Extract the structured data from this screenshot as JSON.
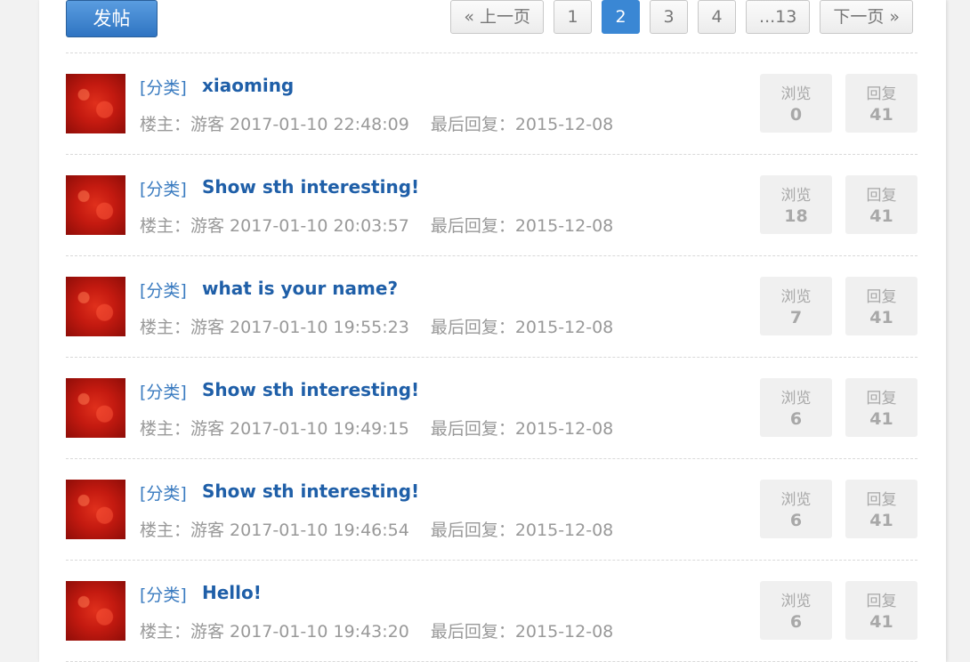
{
  "toolbar": {
    "post_label": "发帖"
  },
  "pagination": {
    "prev": "« 上一页",
    "pages": [
      "1",
      "2",
      "3",
      "4"
    ],
    "active": "2",
    "ellipsis": "...13",
    "next": "下一页 »"
  },
  "threads": [
    {
      "category": "[分类]",
      "title": "xiaoming",
      "host": "楼主：游客 2017-01-10 22:48:09",
      "last_reply": "最后回复：2015-12-08",
      "views_label": "浏览",
      "views": "0",
      "replies_label": "回复",
      "replies": "41"
    },
    {
      "category": "[分类]",
      "title": "Show sth interesting!",
      "host": "楼主：游客 2017-01-10 20:03:57",
      "last_reply": "最后回复：2015-12-08",
      "views_label": "浏览",
      "views": "18",
      "replies_label": "回复",
      "replies": "41"
    },
    {
      "category": "[分类]",
      "title": "what is your name?",
      "host": "楼主：游客 2017-01-10 19:55:23",
      "last_reply": "最后回复：2015-12-08",
      "views_label": "浏览",
      "views": "7",
      "replies_label": "回复",
      "replies": "41"
    },
    {
      "category": "[分类]",
      "title": "Show sth interesting!",
      "host": "楼主：游客 2017-01-10 19:49:15",
      "last_reply": "最后回复：2015-12-08",
      "views_label": "浏览",
      "views": "6",
      "replies_label": "回复",
      "replies": "41"
    },
    {
      "category": "[分类]",
      "title": "Show sth interesting!",
      "host": "楼主：游客 2017-01-10 19:46:54",
      "last_reply": "最后回复：2015-12-08",
      "views_label": "浏览",
      "views": "6",
      "replies_label": "回复",
      "replies": "41"
    },
    {
      "category": "[分类]",
      "title": "Hello!",
      "host": "楼主：游客 2017-01-10 19:43:20",
      "last_reply": "最后回复：2015-12-08",
      "views_label": "浏览",
      "views": "6",
      "replies_label": "回复",
      "replies": "41"
    }
  ]
}
